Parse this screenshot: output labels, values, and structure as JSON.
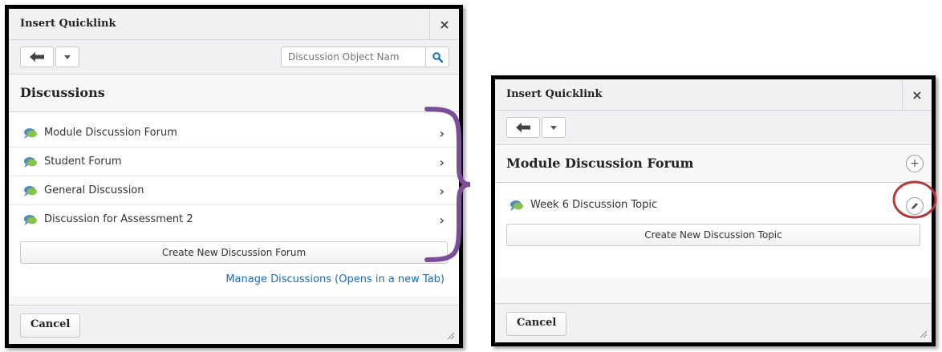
{
  "left_dialog": {
    "title": "Insert Quicklink",
    "close_label": "×",
    "search_placeholder": "Discussion Object Nam",
    "section_title": "Discussions",
    "items": [
      {
        "label": "Module Discussion Forum"
      },
      {
        "label": "Student Forum"
      },
      {
        "label": "General Discussion"
      },
      {
        "label": "Discussion for Assessment 2"
      }
    ],
    "create_label": "Create New Discussion Forum",
    "manage_label": "Manage Discussions (Opens in a new Tab)",
    "cancel_label": "Cancel"
  },
  "right_dialog": {
    "title": "Insert Quicklink",
    "close_label": "×",
    "section_title": "Module Discussion Forum",
    "add_label": "+",
    "items": [
      {
        "label": "Week 6 Discussion Topic"
      }
    ],
    "create_label": "Create New Discussion Topic",
    "cancel_label": "Cancel"
  },
  "colors": {
    "annotation_brace": "#7b4e9a",
    "annotation_circle": "#b33a3a",
    "link": "#1a6db3"
  },
  "icons": {
    "back": "arrow-left-icon",
    "dropdown": "caret-down-icon",
    "search": "magnifier-icon",
    "discussion": "speech-bubble-icon",
    "chevron": "chevron-right-icon",
    "edit": "pencil-icon",
    "add": "plus-circle-icon",
    "resize": "resize-grip-icon"
  }
}
